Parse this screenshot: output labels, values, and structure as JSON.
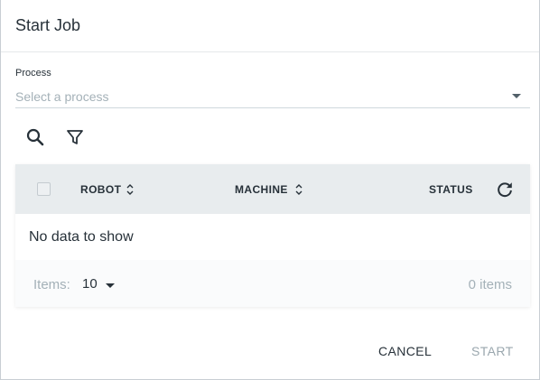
{
  "dialog": {
    "title": "Start Job"
  },
  "process": {
    "label": "Process",
    "placeholder": "Select a process"
  },
  "toolbar": {
    "icons": [
      "search-icon",
      "filter-icon"
    ]
  },
  "grid": {
    "columns": [
      {
        "label": "ROBOT",
        "sortable": true
      },
      {
        "label": "MACHINE",
        "sortable": true
      },
      {
        "label": "STATUS",
        "sortable": false
      }
    ],
    "empty_text": "No data to show",
    "footer": {
      "items_label": "Items:",
      "page_size": "10",
      "count_text": "0 items"
    }
  },
  "actions": {
    "cancel": "CANCEL",
    "start": "START"
  },
  "colors": {
    "header_bg": "#e8ecee",
    "text": "#273139",
    "muted": "#a4b1b8",
    "disabled": "#9aa7ae"
  }
}
